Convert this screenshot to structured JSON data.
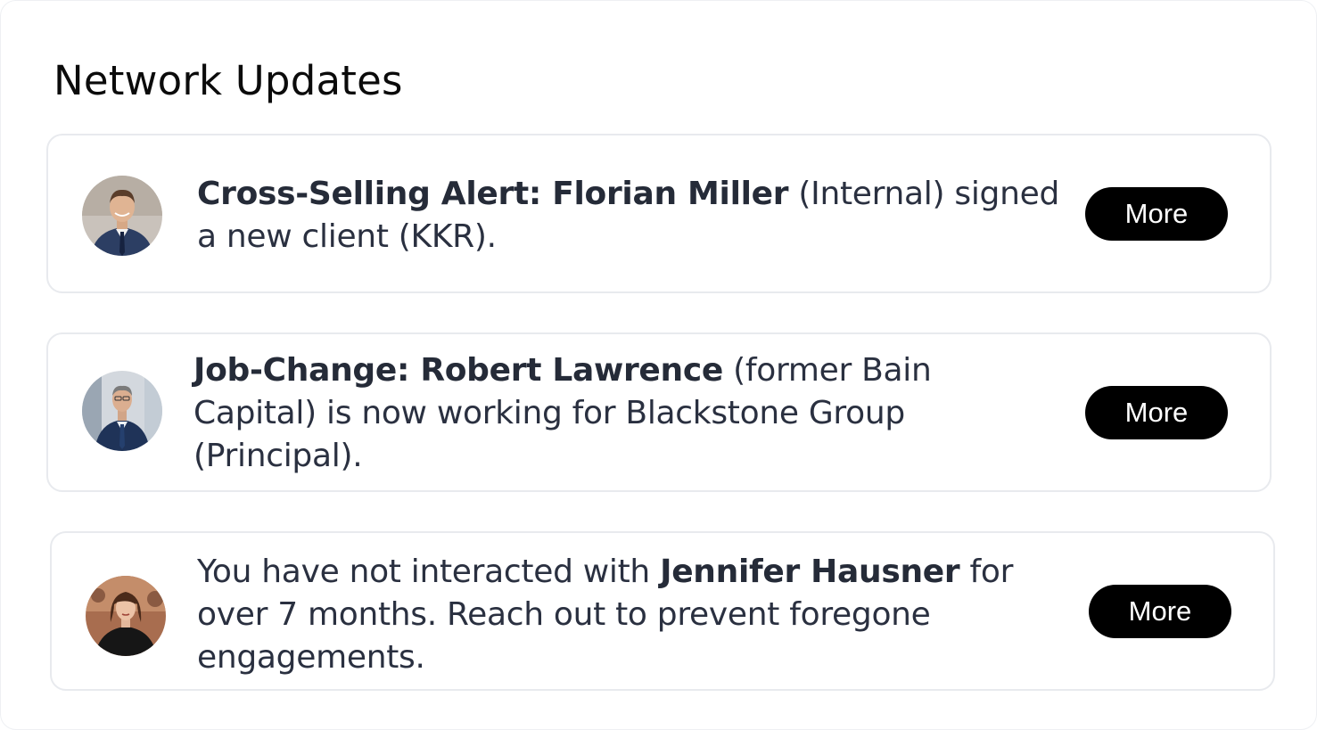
{
  "section": {
    "title": "Network Updates"
  },
  "updates": [
    {
      "bold_1": "Cross-Selling Alert: Florian Miller",
      "text_1": " (Internal) signed a new client (KKR).",
      "button": "More"
    },
    {
      "bold_1": "Job-Change: Robert Lawrence",
      "text_1": " (former Bain Capital) is now working for Blackstone Group (Principal).",
      "button": "More"
    },
    {
      "text_0": "You have not interacted with ",
      "bold_1": "Jennifer Hausner",
      "text_1": " for over 7 months. Reach out to prevent foregone engagements.",
      "button": "More"
    }
  ]
}
